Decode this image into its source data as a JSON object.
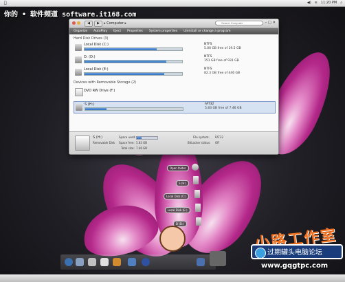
{
  "menubar": {
    "apple": "",
    "clock": "11:20 PM"
  },
  "watermark": "你的 • 软件频道 software.it168.com",
  "window": {
    "breadcrumb": "▸ Computer ▸",
    "search_placeholder": "Search Computer",
    "toolbar": [
      "Organize",
      "AutoPlay",
      "Eject",
      "Properties",
      "System properties",
      "Uninstall or change a program"
    ],
    "hard_disk_section": "Hard Disk Drives (3)",
    "removable_section": "Devices with Removable Storage (2)",
    "drives": [
      {
        "name": "Local Disk (C:)",
        "fs": "NTFS",
        "free": "5.00 GB free of 19.5 GB",
        "used_fraction": 0.74
      },
      {
        "name": "D: (D:)",
        "fs": "NTFS",
        "free": "151 GB free of 931 GB",
        "used_fraction": 0.84
      },
      {
        "name": "Local Disk (E:)",
        "fs": "NTFS",
        "free": "82.3 GB free of 446 GB",
        "used_fraction": 0.82
      }
    ],
    "dvd": {
      "name": "DVD RW Drive (F:)"
    },
    "removable": {
      "name": "S (H:)",
      "fs": "FAT32",
      "free": "5.83 GB free of 7.46 GB",
      "used_fraction": 0.22
    },
    "status": {
      "name": "S (H:)",
      "type": "Removable Disk",
      "space_used_label": "Space used:",
      "space_free_label": "Space free:",
      "space_free": "5.83 GB",
      "total_size_label": "Total size:",
      "total_size": "7.46 GB",
      "fs_label": "File system:",
      "fs": "FAT32",
      "bitlocker_label": "BitLocker status:",
      "bitlocker": "Off"
    }
  },
  "dock_menu": [
    "Open folder",
    "S (H:)",
    "Local Disk (C:)",
    "Local Disk (E:)",
    "D (D:)"
  ],
  "logo_text": "小路工作室",
  "badge_text": "过期罐头电脑论坛",
  "url_text": "www.gqgtpc.com"
}
